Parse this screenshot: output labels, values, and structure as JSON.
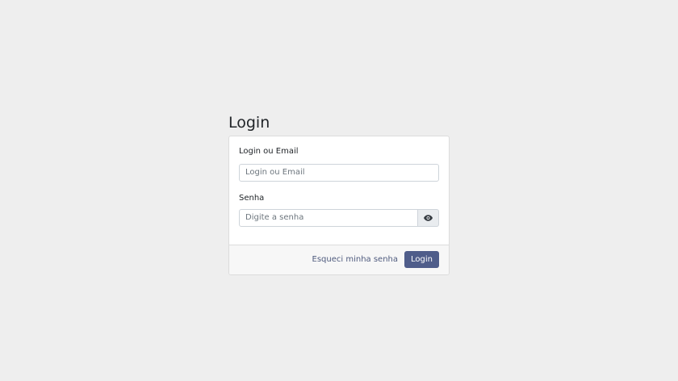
{
  "page": {
    "title": "Login"
  },
  "form": {
    "login_label": "Login ou Email",
    "login_placeholder": "Login ou Email",
    "login_value": "",
    "password_label": "Senha",
    "password_placeholder": "Digite a senha",
    "password_value": "",
    "show_password_icon": "eye-icon"
  },
  "footer": {
    "forgot_label": "Esqueci minha senha",
    "login_button_label": "Login"
  },
  "colors": {
    "background": "#eeeeee",
    "primary_button": "#4f5d8a",
    "link": "#4f5b7e",
    "card_footer": "#f7f7f7"
  }
}
